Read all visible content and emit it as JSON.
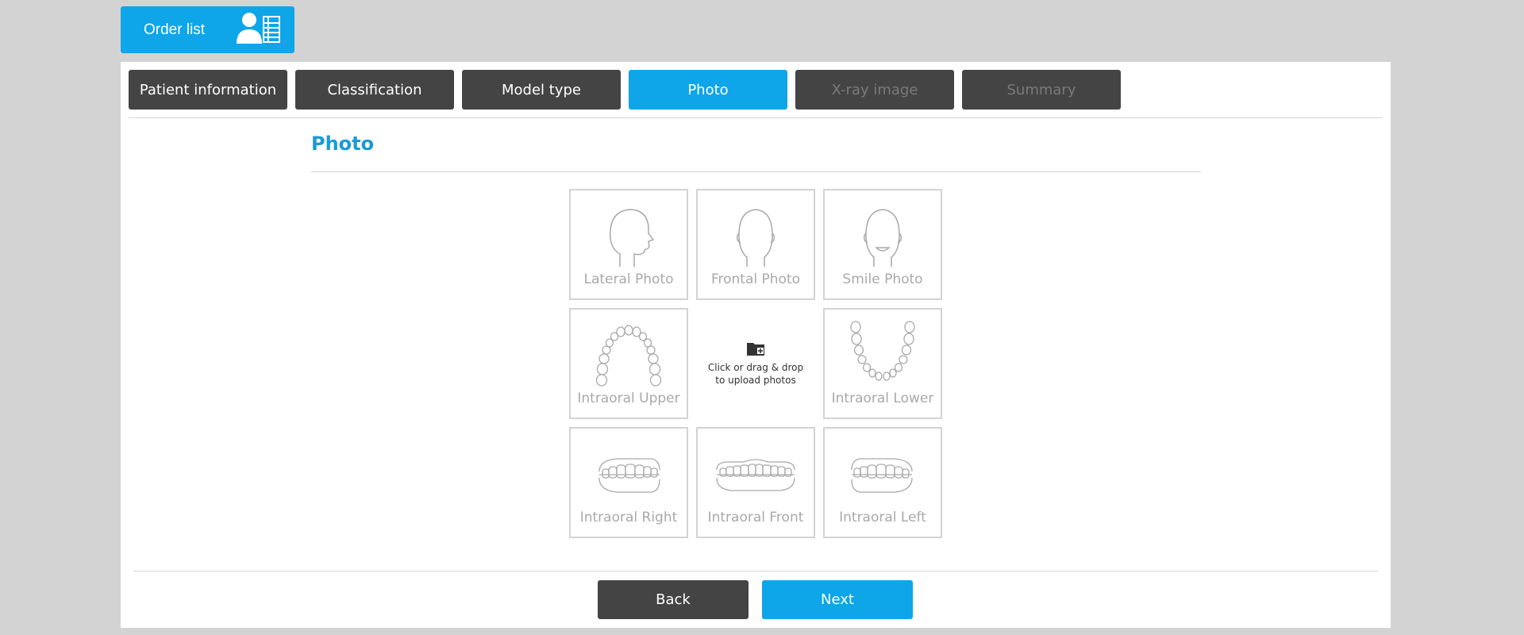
{
  "header": {
    "order_list_label": "Order list"
  },
  "tabs": [
    {
      "label": "Patient information",
      "state": "normal"
    },
    {
      "label": "Classification",
      "state": "normal"
    },
    {
      "label": "Model type",
      "state": "normal"
    },
    {
      "label": "Photo",
      "state": "active"
    },
    {
      "label": "X-ray image",
      "state": "disabled"
    },
    {
      "label": "Summary",
      "state": "disabled"
    }
  ],
  "section": {
    "title": "Photo"
  },
  "photos": {
    "lateral": "Lateral Photo",
    "frontal": "Frontal Photo",
    "smile": "Smile Photo",
    "intraoral_upper": "Intraoral Upper",
    "intraoral_lower": "Intraoral Lower",
    "intraoral_right": "Intraoral Right",
    "intraoral_front": "Intraoral Front",
    "intraoral_left": "Intraoral Left"
  },
  "upload": {
    "line1": "Click or drag & drop",
    "line2": "to upload photos"
  },
  "footer": {
    "back_label": "Back",
    "next_label": "Next"
  },
  "colors": {
    "accent": "#0ea5e9",
    "dark": "#444444",
    "title": "#1a9ad6",
    "tile_border": "#d3d3d3",
    "tile_text": "#a9a9a9"
  }
}
